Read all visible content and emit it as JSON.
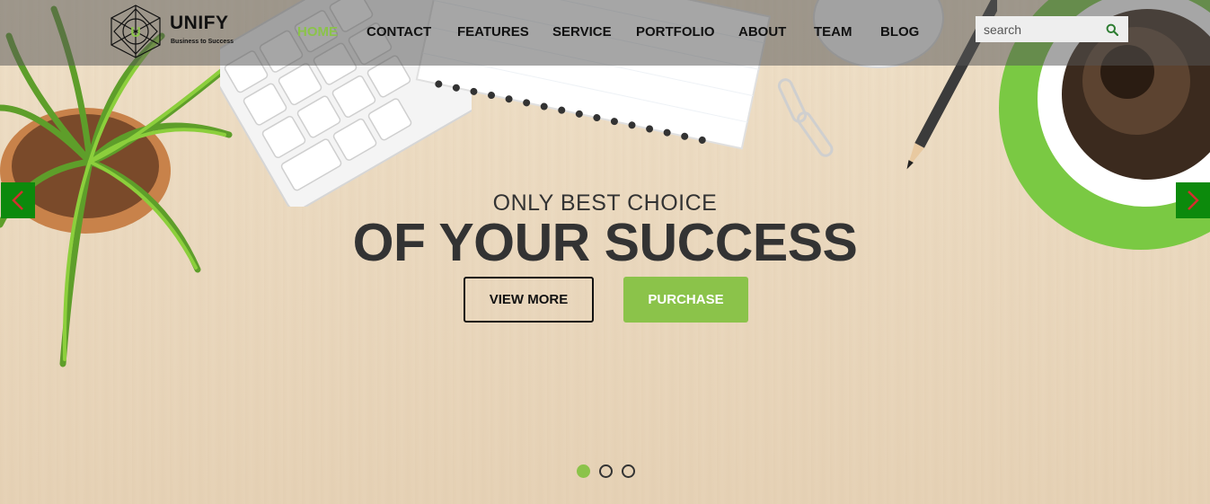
{
  "header": {
    "brand_name": "UNIFY",
    "brand_tagline": "Business to Success",
    "nav": [
      {
        "label": "HOME",
        "active": true
      },
      {
        "label": "CONTACT",
        "active": false
      },
      {
        "label": "FEATURES",
        "active": false
      },
      {
        "label": "SERVICE",
        "active": false
      },
      {
        "label": "PORTFOLIO",
        "active": false
      },
      {
        "label": "ABOUT",
        "active": false
      },
      {
        "label": "TEAM",
        "active": false
      },
      {
        "label": "BLOG",
        "active": false
      }
    ],
    "search": {
      "placeholder": "search",
      "value": "",
      "icon": "search-icon"
    }
  },
  "hero": {
    "subtitle": "ONLY BEST CHOICE",
    "title": "OF YOUR SUCCESS",
    "buttons": {
      "view_more": "VIEW MORE",
      "purchase": "PURCHASE"
    },
    "arrows": {
      "prev_icon": "chevron-left-icon",
      "next_icon": "chevron-right-icon"
    },
    "slides": {
      "count": 3,
      "active_index": 0
    }
  },
  "colors": {
    "accent": "#8bc34a",
    "arrow_bg": "#0c8a0c",
    "arrow_glyph": "#d32f2f",
    "text_dark": "#333333"
  }
}
